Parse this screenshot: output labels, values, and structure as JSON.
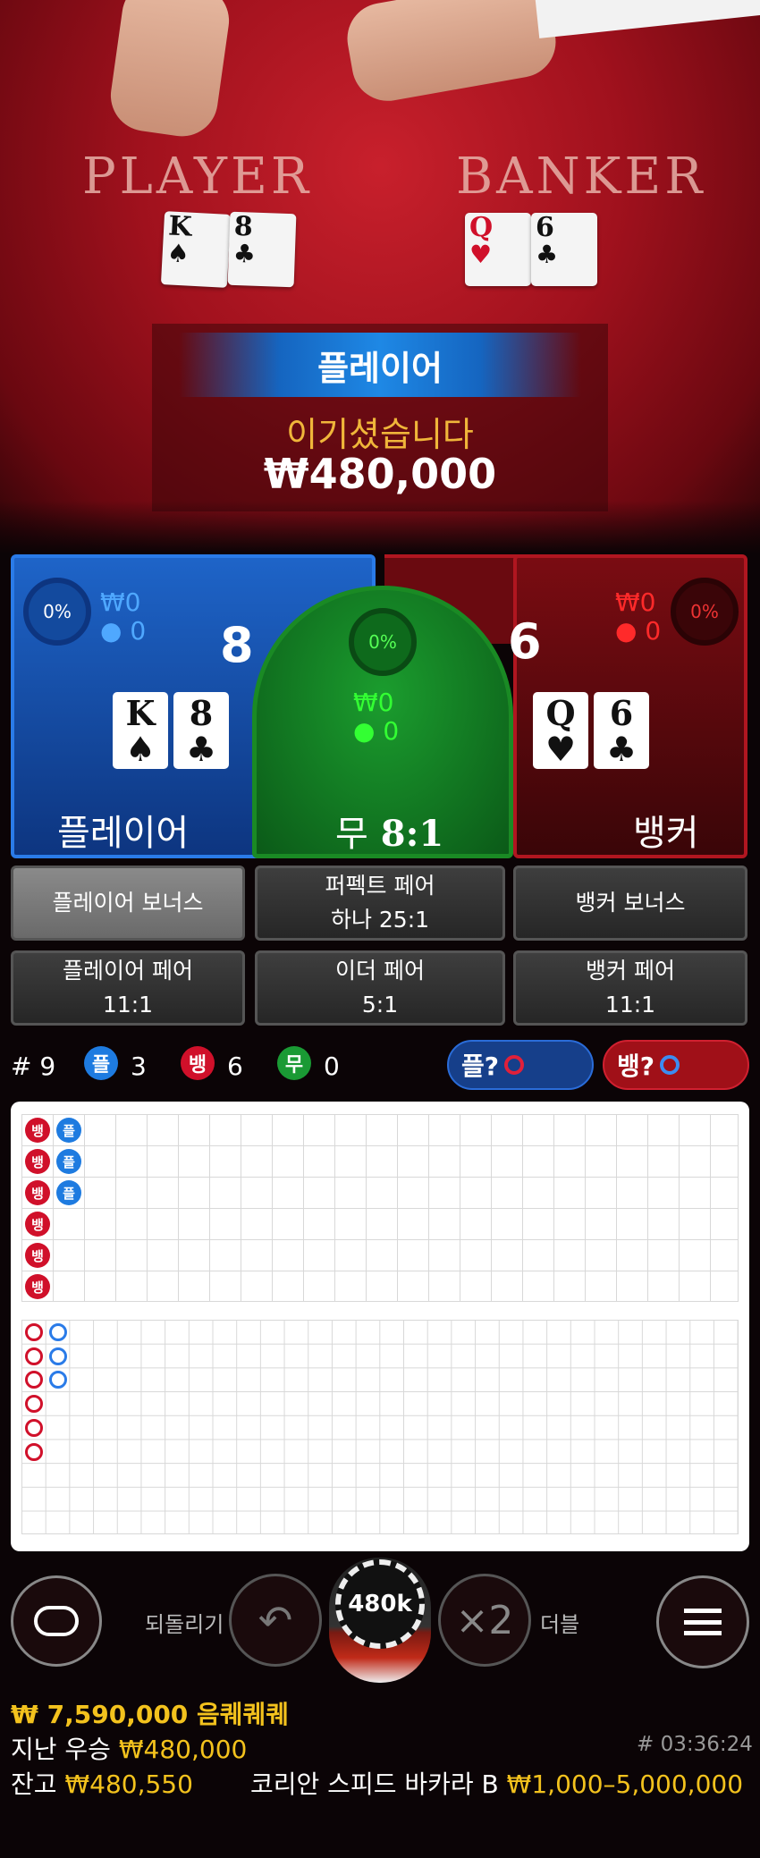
{
  "video": {
    "player_label": "PLAYER",
    "banker_label": "BANKER",
    "player_cards": [
      {
        "rank": "K",
        "suit": "♠"
      },
      {
        "rank": "8",
        "suit": "♣"
      }
    ],
    "banker_cards": [
      {
        "rank": "Q",
        "suit": "♥"
      },
      {
        "rank": "6",
        "suit": "♣"
      }
    ]
  },
  "result": {
    "winner": "플레이어",
    "message": "이기셨습니다",
    "amount": "₩480,000"
  },
  "player_zone": {
    "percent": "0%",
    "amount": "₩0",
    "players": "0",
    "score": "8",
    "card1": "K",
    "suit1": "♠",
    "card2": "8",
    "suit2": "♣",
    "label": "플레이어"
  },
  "tie_zone": {
    "percent": "0%",
    "amount": "₩0",
    "players": "0",
    "label": "무",
    "payout": "8:1"
  },
  "banker_zone": {
    "percent": "0%",
    "amount": "₩0",
    "players": "0",
    "score": "6",
    "card1": "Q",
    "suit1": "♥",
    "card2": "6",
    "suit2": "♣",
    "label": "뱅커"
  },
  "side_bets": {
    "player_bonus": "플레이어 보너스",
    "perfect_pair_1": "퍼펙트 페어",
    "perfect_pair_2": "하나 25:1",
    "banker_bonus": "뱅커 보너스",
    "player_pair_1": "플레이어 페어",
    "player_pair_2": "11:1",
    "either_pair_1": "이더 페어",
    "either_pair_2": "5:1",
    "banker_pair_1": "뱅커 페어",
    "banker_pair_2": "11:1"
  },
  "stats": {
    "round": "# 9",
    "player_char": "플",
    "player_count": "3",
    "banker_char": "뱅",
    "banker_count": "6",
    "tie_char": "무",
    "tie_count": "0",
    "player_predict": "플?",
    "banker_predict": "뱅?"
  },
  "controls": {
    "undo_label": "되돌리기",
    "chip_value": "480k",
    "double_icon": "×2",
    "double_label": "더블"
  },
  "footer": {
    "jackpot": "₩ 7,590,000 음퀘퀘퀘",
    "last_win_label": "지난 우승",
    "last_win_amount": "₩480,000",
    "game_id": "# 03:36:24",
    "balance_label": "잔고",
    "balance_amount": "₩480,550",
    "table_name": "코리안 스피드 바카라 B",
    "limits": "₩1,000–5,000,000"
  },
  "colors": {
    "player": "#1e64c8",
    "banker": "#b01620",
    "tie": "#1b9d2e",
    "gold": "#f3c21d"
  }
}
